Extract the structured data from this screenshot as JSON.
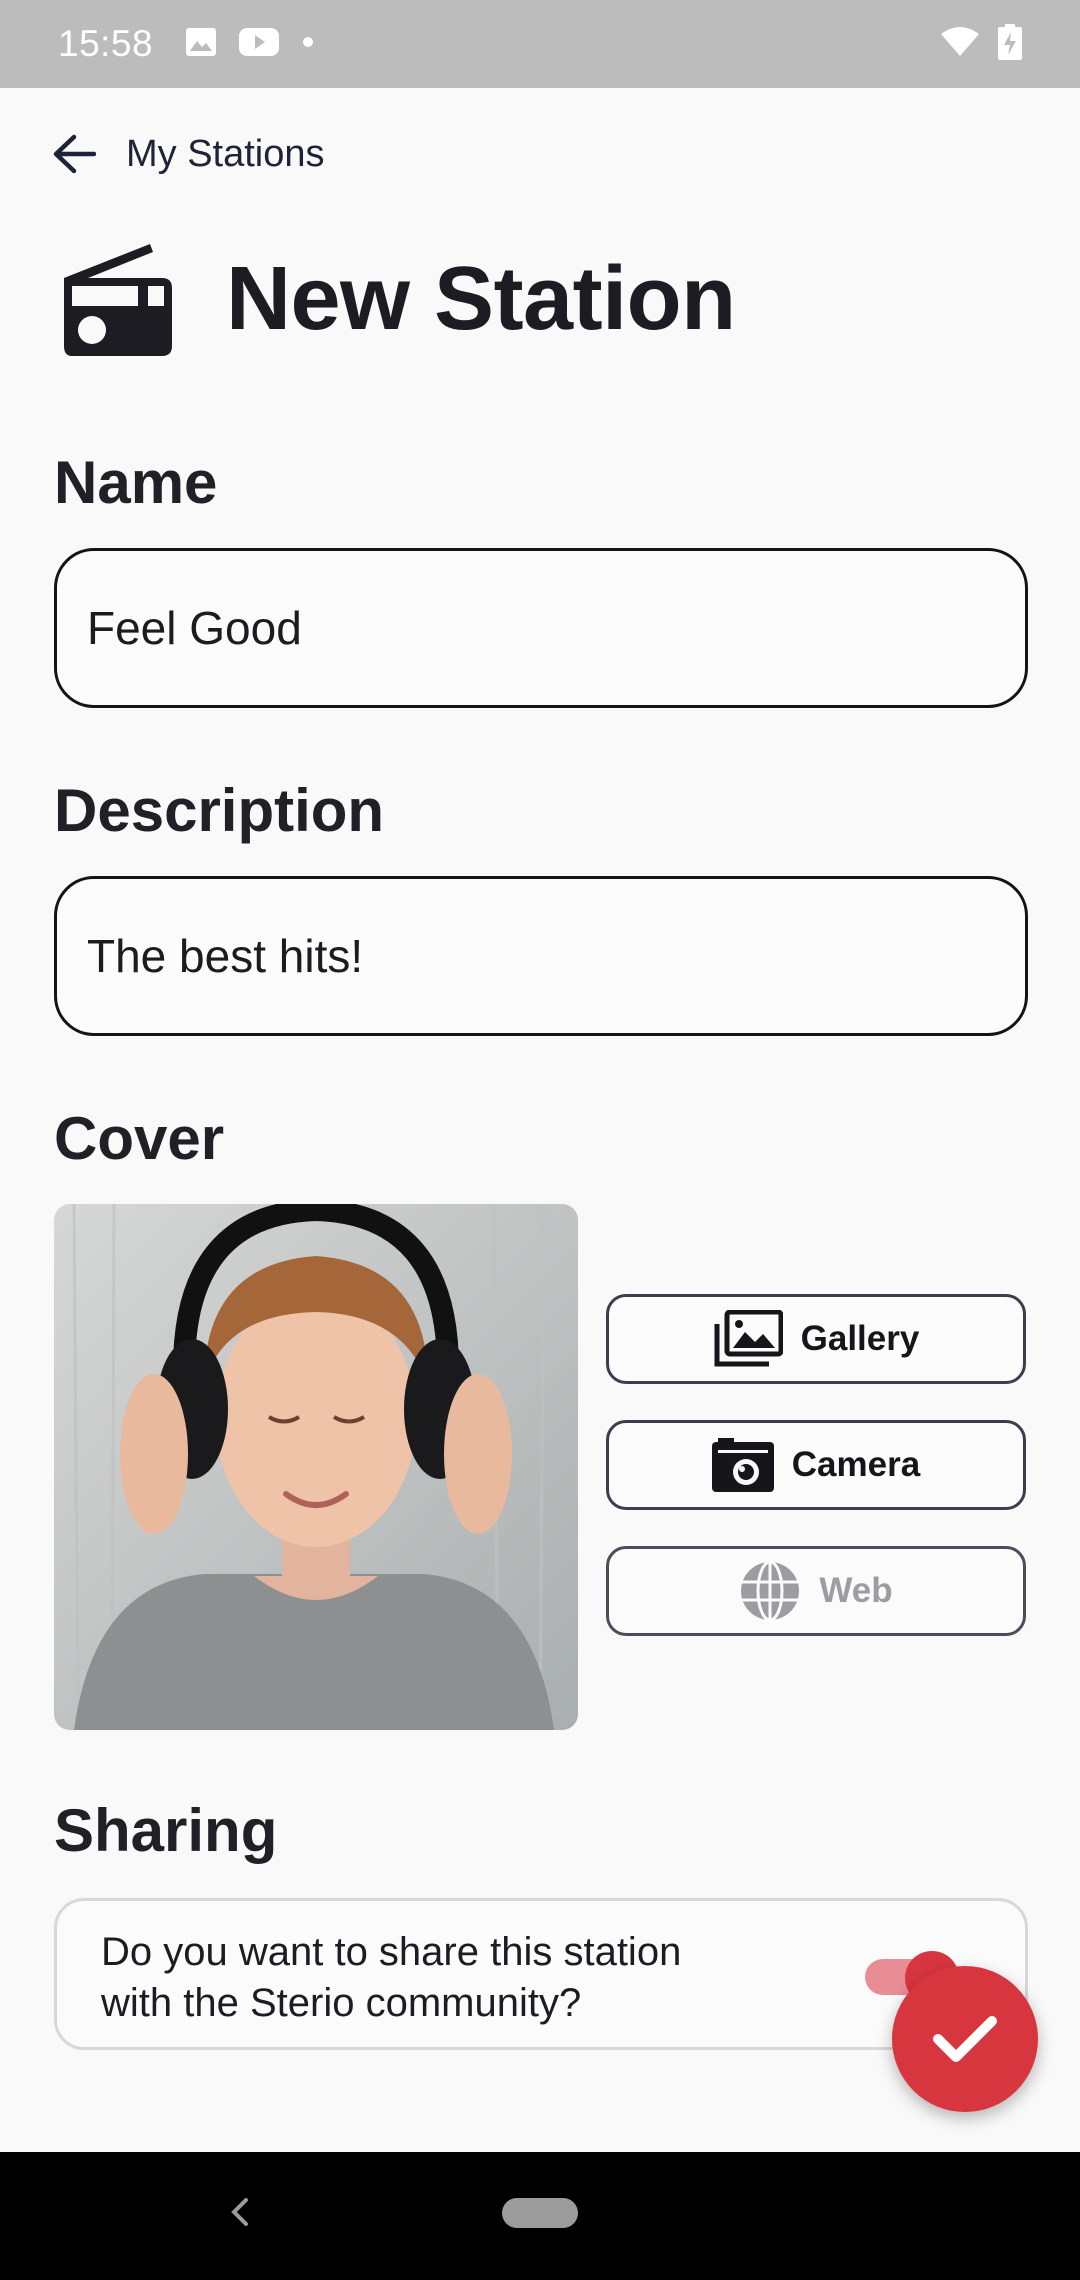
{
  "status_bar": {
    "time": "15:58",
    "left_icons": [
      "image-icon",
      "youtube-icon",
      "dot-icon"
    ],
    "right_icons": [
      "wifi-icon",
      "battery-charging-icon"
    ]
  },
  "nav": {
    "back_label": "My Stations"
  },
  "header": {
    "icon": "radio-icon",
    "title": "New Station"
  },
  "form": {
    "name": {
      "label": "Name",
      "value": "Feel Good"
    },
    "description": {
      "label": "Description",
      "value": "The best hits!"
    },
    "cover": {
      "label": "Cover",
      "buttons": [
        {
          "label": "Gallery",
          "icon": "gallery-icon",
          "enabled": true
        },
        {
          "label": "Camera",
          "icon": "camera-icon",
          "enabled": true
        },
        {
          "label": "Web",
          "icon": "globe-icon",
          "enabled": false
        }
      ]
    },
    "sharing": {
      "label": "Sharing",
      "question": "Do you want to share this station with the Sterio community?",
      "enabled": true
    }
  },
  "fab": {
    "icon": "check-icon"
  },
  "colors": {
    "accent": "#d8363f",
    "toggle_track": "#e98d95",
    "background": "#f9f9fa",
    "status_bar": "#bcbcbc"
  }
}
